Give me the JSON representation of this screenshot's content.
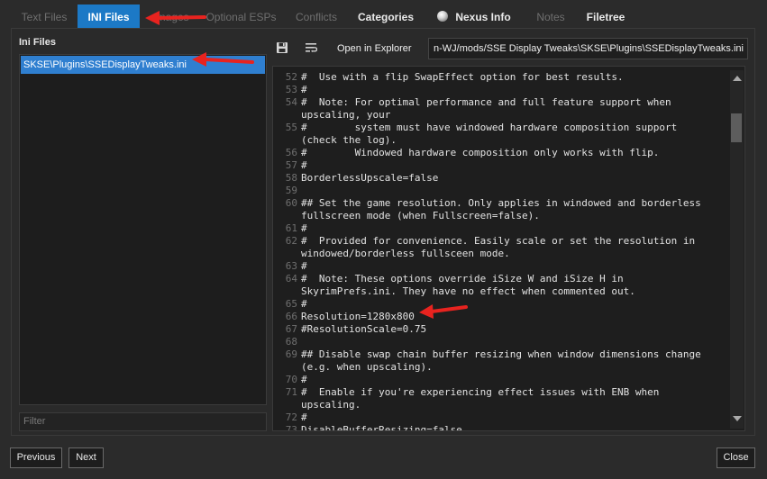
{
  "tabs": [
    {
      "label": "Text Files",
      "state": "disabled"
    },
    {
      "label": "INI Files",
      "state": "active"
    },
    {
      "label": "Images",
      "state": "disabled"
    },
    {
      "label": "Optional ESPs",
      "state": "disabled"
    },
    {
      "label": "Conflicts",
      "state": "disabled"
    },
    {
      "label": "Categories",
      "state": "enabled"
    },
    {
      "label": "Nexus Info",
      "state": "enabled",
      "icon": "nexus-globe-icon"
    },
    {
      "label": "Notes",
      "state": "disabled"
    },
    {
      "label": "Filetree",
      "state": "enabled"
    }
  ],
  "ini_panel": {
    "heading": "Ini Files",
    "files": [
      "SKSE\\Plugins\\SSEDisplayTweaks.ini"
    ],
    "selected_file": "SKSE\\Plugins\\SSEDisplayTweaks.ini",
    "filter_placeholder": "Filter"
  },
  "toolbar": {
    "save_icon": "floppy-disk-icon",
    "wrap_icon": "word-wrap-icon",
    "open_explorer_label": "Open in Explorer",
    "path": "n-WJ/mods/SSE Display Tweaks\\SKSE\\Plugins\\SSEDisplayTweaks.ini"
  },
  "editor": {
    "lines": [
      {
        "num": "52",
        "text": "#  Use with a flip SwapEffect option for best results."
      },
      {
        "num": "53",
        "text": "#"
      },
      {
        "num": "54",
        "text": "#  Note: For optimal performance and full feature support when"
      },
      {
        "num": "",
        "text": "upscaling, your"
      },
      {
        "num": "55",
        "text": "#        system must have windowed hardware composition support"
      },
      {
        "num": "",
        "text": "(check the log)."
      },
      {
        "num": "56",
        "text": "#        Windowed hardware composition only works with flip."
      },
      {
        "num": "57",
        "text": "#"
      },
      {
        "num": "58",
        "text": "BorderlessUpscale=false"
      },
      {
        "num": "59",
        "text": ""
      },
      {
        "num": "60",
        "text": "## Set the game resolution. Only applies in windowed and borderless"
      },
      {
        "num": "",
        "text": "fullscreen mode (when Fullscreen=false)."
      },
      {
        "num": "61",
        "text": "#"
      },
      {
        "num": "62",
        "text": "#  Provided for convenience. Easily scale or set the resolution in"
      },
      {
        "num": "",
        "text": "windowed/borderless fullsceen mode."
      },
      {
        "num": "63",
        "text": "#"
      },
      {
        "num": "64",
        "text": "#  Note: These options override iSize W and iSize H in"
      },
      {
        "num": "",
        "text": "SkyrimPrefs.ini. They have no effect when commented out."
      },
      {
        "num": "65",
        "text": "#"
      },
      {
        "num": "66",
        "text": "Resolution=1280x800"
      },
      {
        "num": "67",
        "text": "#ResolutionScale=0.75"
      },
      {
        "num": "68",
        "text": ""
      },
      {
        "num": "69",
        "text": "## Disable swap chain buffer resizing when window dimensions change"
      },
      {
        "num": "",
        "text": "(e.g. when upscaling)."
      },
      {
        "num": "70",
        "text": "#"
      },
      {
        "num": "71",
        "text": "#  Enable if you're experiencing effect issues with ENB when"
      },
      {
        "num": "",
        "text": "upscaling."
      },
      {
        "num": "72",
        "text": "#"
      },
      {
        "num": "73",
        "text": "DisableBufferResizing=false"
      }
    ]
  },
  "buttons": {
    "previous": "Previous",
    "next": "Next",
    "close": "Close"
  },
  "colors": {
    "active_tab": "#1c79c6",
    "selection": "#2f7fd0",
    "annotation_arrow": "#e8231f"
  },
  "annotations": [
    "red-arrow-icon",
    "red-arrow-icon",
    "red-arrow-icon"
  ]
}
